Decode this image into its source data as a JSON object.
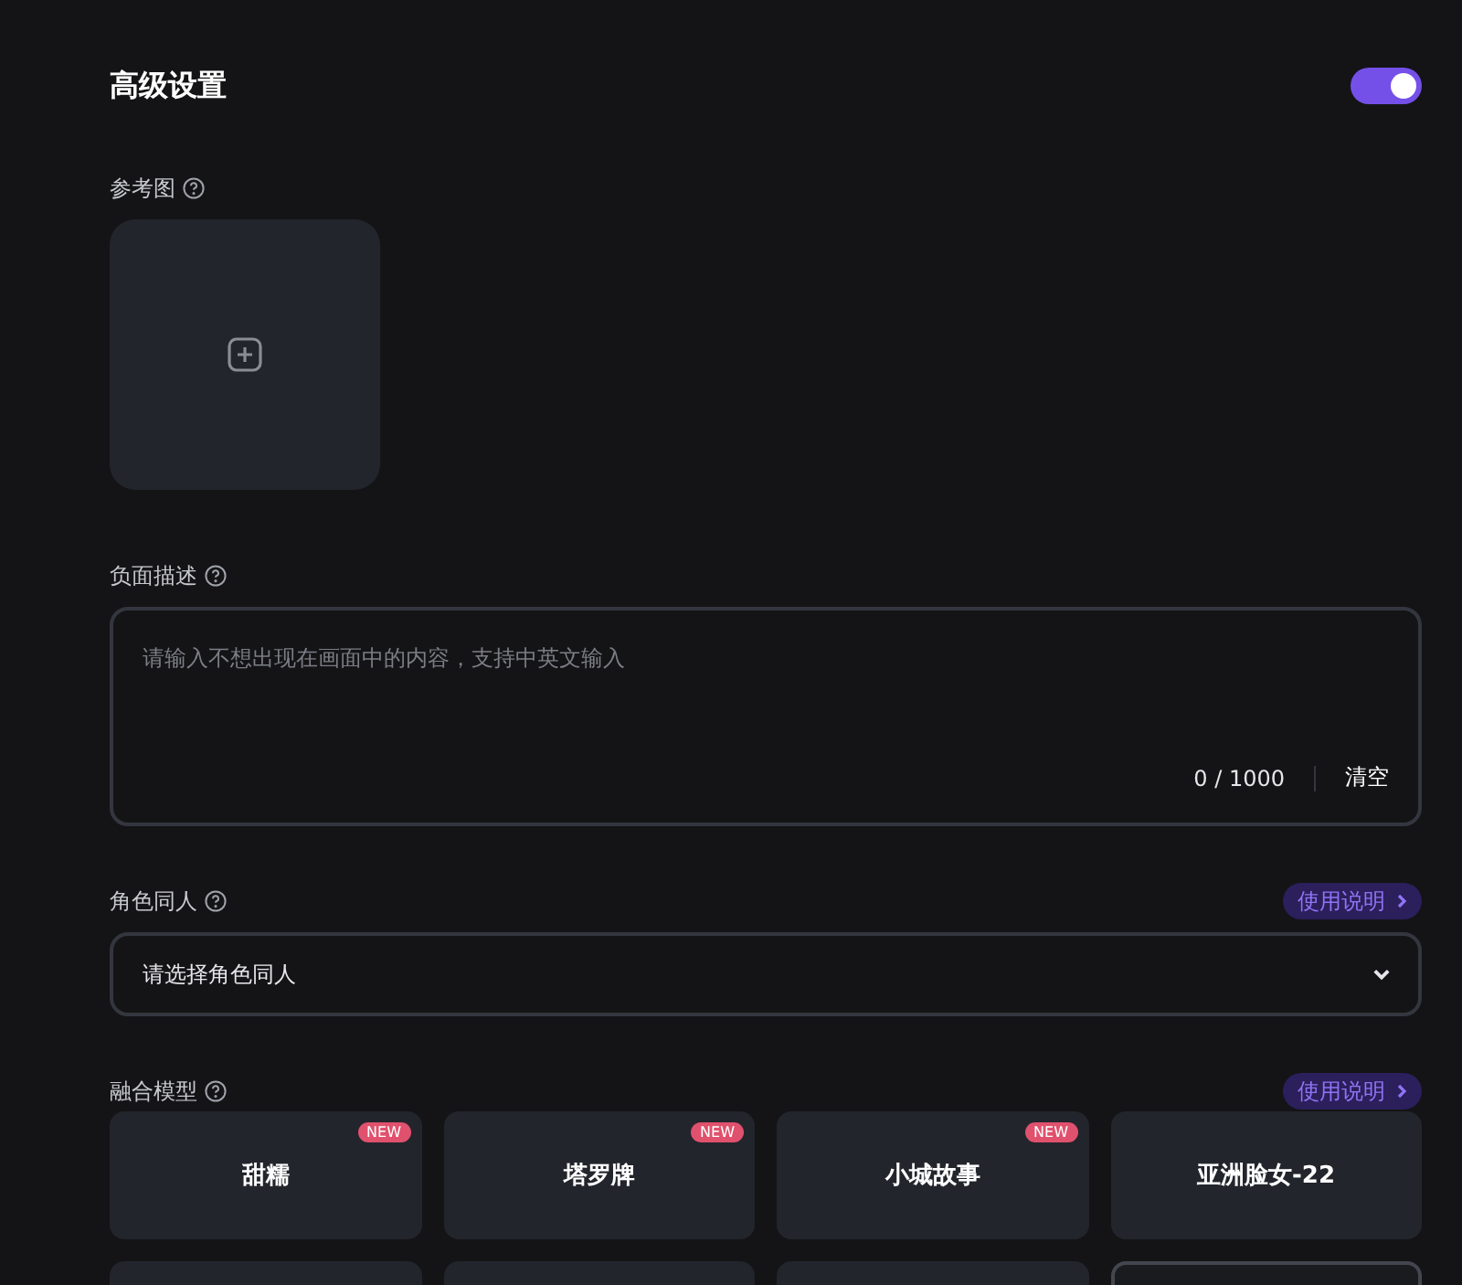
{
  "header": {
    "title": "高级设置",
    "toggle": {
      "on": true
    }
  },
  "reference": {
    "label": "参考图"
  },
  "negative": {
    "label": "负面描述",
    "placeholder": "请输入不想出现在画面中的内容，支持中英文输入",
    "counter": "0 / 1000",
    "clear": "清空"
  },
  "character": {
    "label": "角色同人",
    "help_link": "使用说明",
    "select_placeholder": "请选择角色同人"
  },
  "models": {
    "label": "融合模型",
    "help_link": "使用说明",
    "items": [
      {
        "name": "甜糯",
        "badge": "NEW",
        "selected": false
      },
      {
        "name": "塔罗牌",
        "badge": "NEW",
        "selected": false
      },
      {
        "name": "小城故事",
        "badge": "NEW",
        "selected": false
      },
      {
        "name": "亚洲脸女-22",
        "selected": false
      },
      {
        "selected": false
      },
      {
        "selected": false
      },
      {
        "selected": false
      },
      {
        "selected": true
      }
    ]
  }
}
